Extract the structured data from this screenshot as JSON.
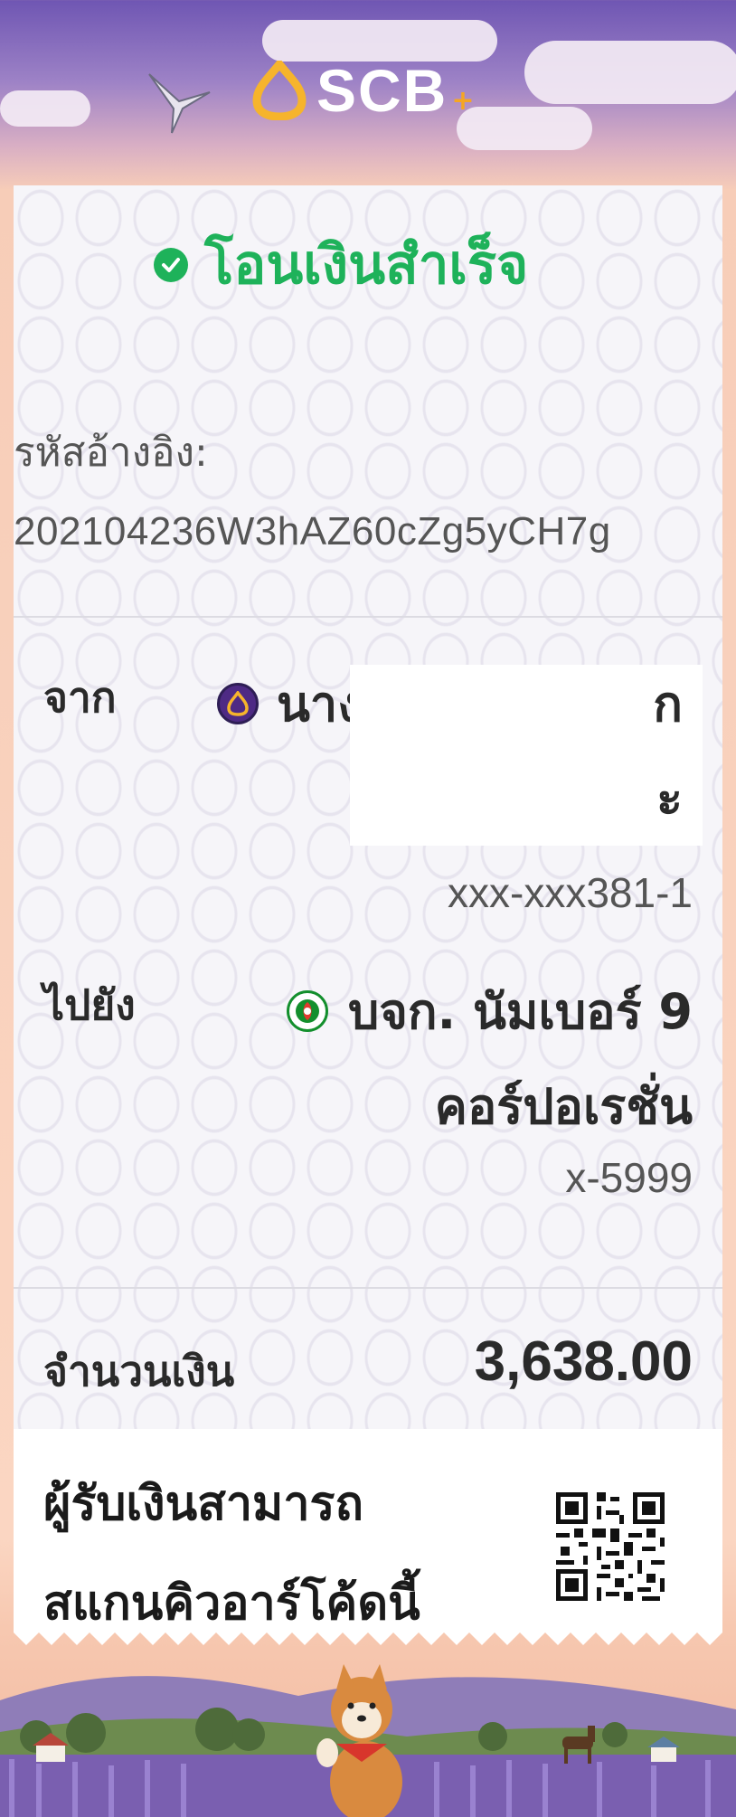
{
  "header": {
    "logo_text": "SCB",
    "logo_plus": "+"
  },
  "receipt": {
    "status": "โอนเงินสำเร็จ",
    "reference_label": "รหัสอ้างอิง:",
    "reference_value": "202104236W3hAZ60cZg5yCH7g",
    "from_label": "จาก",
    "from_name_visible": "นาง",
    "from_account": "xxx-xxx381-1",
    "to_label": "ไปยัง",
    "to_name_line1": "บจก. นัมเบอร์ 9",
    "to_name_line2": "คอร์ปอเรชั่น",
    "to_account": "x-5999",
    "amount_label": "จำนวนเงิน",
    "amount_value": "3,638.00",
    "scan_line1": "ผู้รับเงินสามารถ",
    "scan_line2": "สแกนคิวอาร์โค้ดนี้"
  },
  "icons": {
    "status": "check-circle-icon",
    "from_bank": "scb-bank-icon",
    "to_bank": "kbank-icon",
    "qr": "qr-code-icon"
  },
  "colors": {
    "success": "#1eb25a",
    "scb_purple": "#4e2a84",
    "scb_gold": "#f6a623",
    "kbank_green": "#138f2d"
  }
}
